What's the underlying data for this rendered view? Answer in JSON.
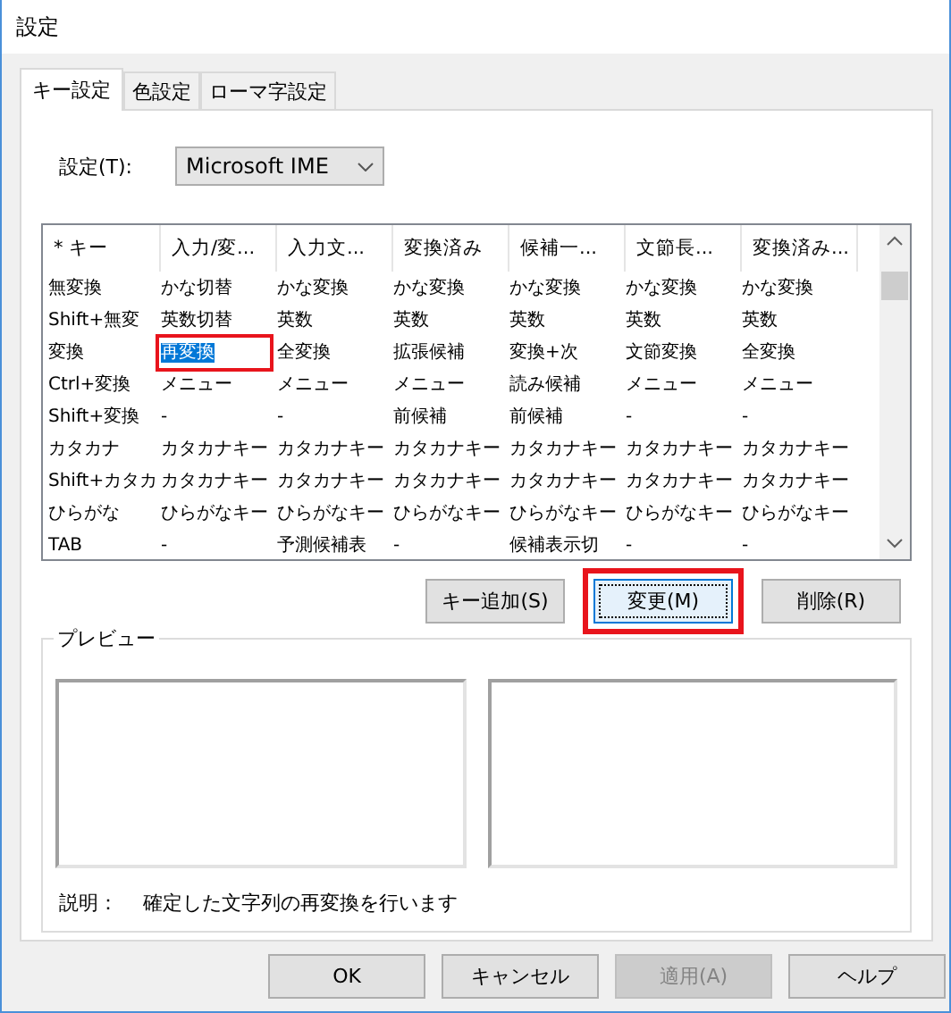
{
  "window": {
    "title": "設定"
  },
  "tabs": [
    {
      "label": "キー設定",
      "selected": true
    },
    {
      "label": "色設定",
      "selected": false
    },
    {
      "label": "ローマ字設定",
      "selected": false
    }
  ],
  "profile": {
    "label": "設定(T):",
    "value": "Microsoft IME"
  },
  "keymap": {
    "columns": [
      "* キー",
      "入力/変...",
      "入力文...",
      "変換済み",
      "候補一...",
      "文節長...",
      "変換済み..."
    ],
    "rows": [
      {
        "cells": [
          {
            "text": "無変換",
            "selected": false
          },
          {
            "text": "かな切替",
            "selected": false
          },
          {
            "text": "かな変換",
            "selected": false
          },
          {
            "text": "かな変換",
            "selected": false
          },
          {
            "text": "かな変換",
            "selected": false
          },
          {
            "text": "かな変換",
            "selected": false
          },
          {
            "text": "かな変換",
            "selected": false
          }
        ]
      },
      {
        "cells": [
          {
            "text": "Shift+無変",
            "selected": false
          },
          {
            "text": "英数切替",
            "selected": false
          },
          {
            "text": "英数",
            "selected": false
          },
          {
            "text": "英数",
            "selected": false
          },
          {
            "text": "英数",
            "selected": false
          },
          {
            "text": "英数",
            "selected": false
          },
          {
            "text": "英数",
            "selected": false
          }
        ]
      },
      {
        "cells": [
          {
            "text": "変換",
            "selected": false
          },
          {
            "text": "再変換",
            "selected": true,
            "highlighted": true
          },
          {
            "text": "全変換",
            "selected": false
          },
          {
            "text": "拡張候補",
            "selected": false
          },
          {
            "text": "変換+次",
            "selected": false
          },
          {
            "text": "文節変換",
            "selected": false
          },
          {
            "text": "全変換",
            "selected": false
          }
        ]
      },
      {
        "cells": [
          {
            "text": "Ctrl+変換",
            "selected": false
          },
          {
            "text": "メニュー",
            "selected": false
          },
          {
            "text": "メニュー",
            "selected": false
          },
          {
            "text": "メニュー",
            "selected": false
          },
          {
            "text": "読み候補",
            "selected": false
          },
          {
            "text": "メニュー",
            "selected": false
          },
          {
            "text": "メニュー",
            "selected": false
          }
        ]
      },
      {
        "cells": [
          {
            "text": "Shift+変換",
            "selected": false
          },
          {
            "text": "-",
            "selected": false
          },
          {
            "text": "-",
            "selected": false
          },
          {
            "text": "前候補",
            "selected": false
          },
          {
            "text": "前候補",
            "selected": false
          },
          {
            "text": "-",
            "selected": false
          },
          {
            "text": "-",
            "selected": false
          }
        ]
      },
      {
        "cells": [
          {
            "text": "カタカナ",
            "selected": false
          },
          {
            "text": "カタカナキー",
            "selected": false
          },
          {
            "text": "カタカナキー",
            "selected": false
          },
          {
            "text": "カタカナキー",
            "selected": false
          },
          {
            "text": "カタカナキー",
            "selected": false
          },
          {
            "text": "カタカナキー",
            "selected": false
          },
          {
            "text": "カタカナキー",
            "selected": false
          }
        ]
      },
      {
        "cells": [
          {
            "text": "Shift+カタカ",
            "selected": false
          },
          {
            "text": "カタカナキー",
            "selected": false
          },
          {
            "text": "カタカナキー",
            "selected": false
          },
          {
            "text": "カタカナキー",
            "selected": false
          },
          {
            "text": "カタカナキー",
            "selected": false
          },
          {
            "text": "カタカナキー",
            "selected": false
          },
          {
            "text": "カタカナキー",
            "selected": false
          }
        ]
      },
      {
        "cells": [
          {
            "text": "ひらがな",
            "selected": false
          },
          {
            "text": "ひらがなキー",
            "selected": false
          },
          {
            "text": "ひらがなキー",
            "selected": false
          },
          {
            "text": "ひらがなキー",
            "selected": false
          },
          {
            "text": "ひらがなキー",
            "selected": false
          },
          {
            "text": "ひらがなキー",
            "selected": false
          },
          {
            "text": "ひらがなキー",
            "selected": false
          }
        ]
      },
      {
        "cells": [
          {
            "text": "TAB",
            "selected": false
          },
          {
            "text": "-",
            "selected": false
          },
          {
            "text": "予測候補表",
            "selected": false
          },
          {
            "text": "-",
            "selected": false
          },
          {
            "text": "候補表示切",
            "selected": false
          },
          {
            "text": "-",
            "selected": false
          },
          {
            "text": "-",
            "selected": false
          }
        ]
      }
    ]
  },
  "key_buttons": [
    {
      "label": "キー追加(S)",
      "highlighted": false
    },
    {
      "label": "変更(M)",
      "highlighted": true
    },
    {
      "label": "削除(R)",
      "highlighted": false
    }
  ],
  "preview": {
    "title": "プレビュー",
    "description_label": "説明：",
    "description": "確定した文字列の再変換を行います"
  },
  "buttons": [
    {
      "label": "OK",
      "disabled": false
    },
    {
      "label": "キャンセル",
      "disabled": false
    },
    {
      "label": "適用(A)",
      "disabled": true
    },
    {
      "label": "ヘルプ",
      "disabled": false
    }
  ]
}
